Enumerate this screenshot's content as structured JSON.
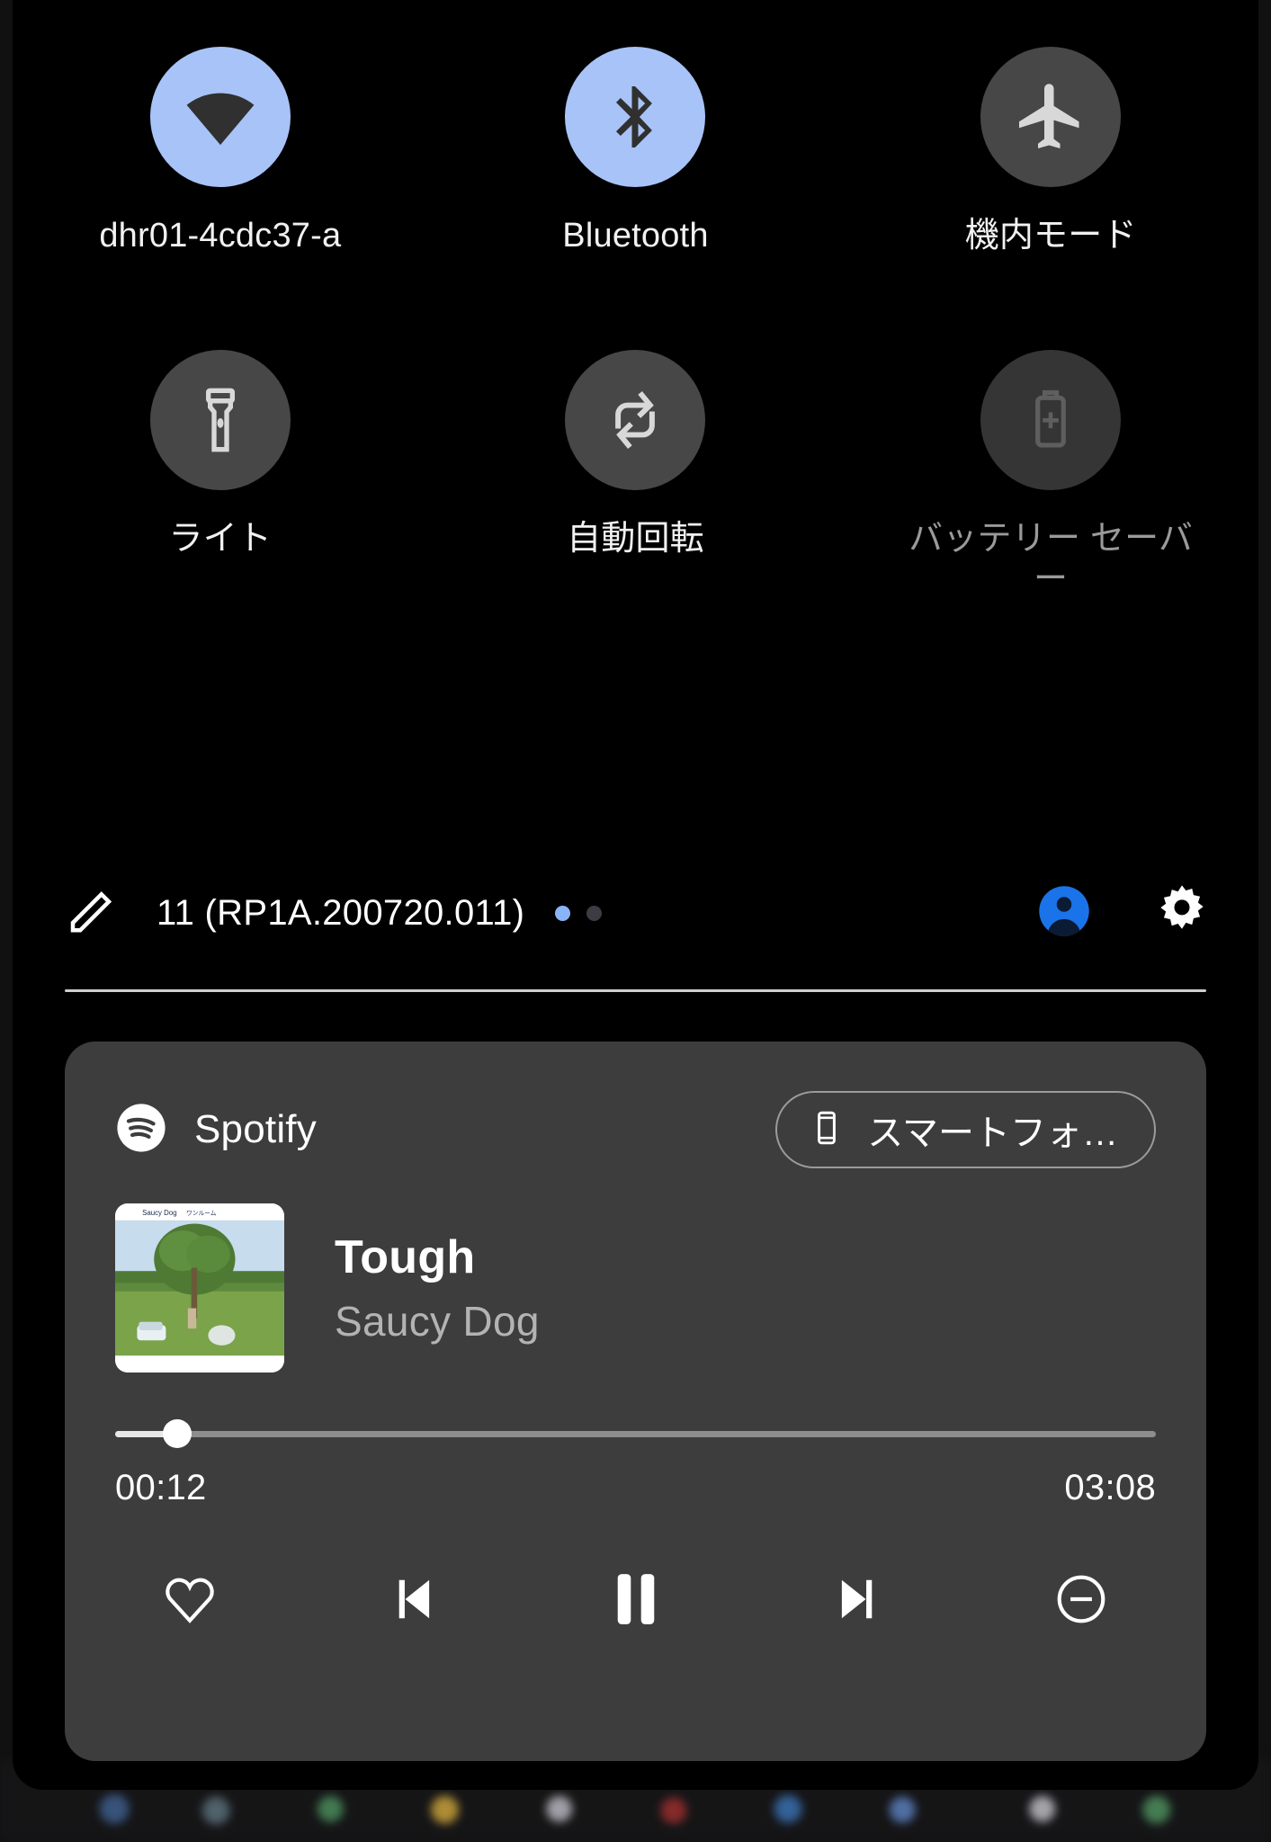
{
  "quick_settings": {
    "tiles": [
      {
        "label": "dhr01-4cdc37-a",
        "icon": "wifi-icon",
        "state": "on"
      },
      {
        "label": "Bluetooth",
        "icon": "bluetooth-icon",
        "state": "on"
      },
      {
        "label": "機内モード",
        "icon": "airplane-icon",
        "state": "off"
      },
      {
        "label": "ライト",
        "icon": "flashlight-icon",
        "state": "off"
      },
      {
        "label": "自動回転",
        "icon": "auto-rotate-icon",
        "state": "off"
      },
      {
        "label": "バッテリー セーバー",
        "icon": "battery-saver-icon",
        "state": "dim"
      }
    ],
    "footer": {
      "edit_icon": "pencil-icon",
      "build_number": "11 (RP1A.200720.011)",
      "pages": [
        {
          "active": true
        },
        {
          "active": false
        }
      ],
      "user_icon": "user-avatar-icon",
      "settings_icon": "gear-icon"
    }
  },
  "media_player": {
    "app_icon": "spotify-logo-icon",
    "app_name": "Spotify",
    "output_device": {
      "icon": "smartphone-icon",
      "label": "スマートフォ…"
    },
    "album_art_alt": "Saucy Dog album cover",
    "album_art_caption": "Saucy Dog",
    "track_title": "Tough",
    "track_artist": "Saucy Dog",
    "progress": {
      "elapsed": "00:12",
      "duration": "03:08",
      "percent": 6
    },
    "controls": [
      {
        "name": "favorite-button",
        "icon": "heart-icon"
      },
      {
        "name": "previous-button",
        "icon": "skip-previous-icon"
      },
      {
        "name": "play-pause-button",
        "icon": "pause-icon"
      },
      {
        "name": "next-button",
        "icon": "skip-next-icon"
      },
      {
        "name": "dismiss-button",
        "icon": "minus-circle-icon"
      }
    ]
  },
  "colors": {
    "tile_on": "#a8c3f7",
    "tile_off": "#474747",
    "accent_blue": "#8ab4f8",
    "card_bg": "#3d3d3d",
    "panel_bg": "#000000"
  }
}
